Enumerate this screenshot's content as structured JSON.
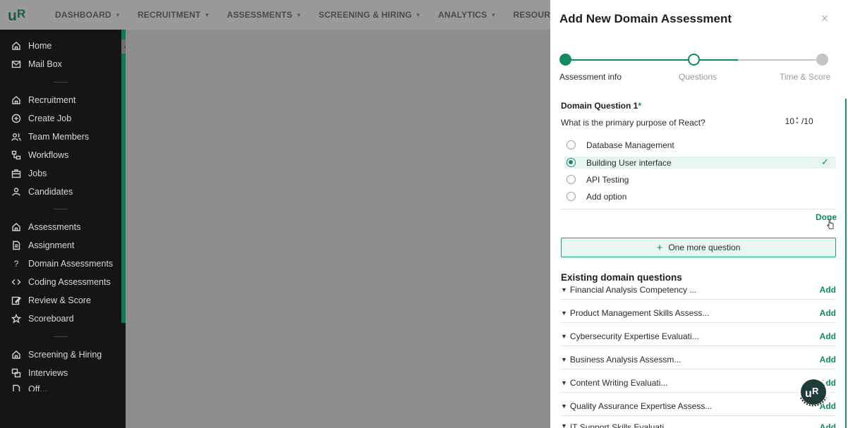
{
  "nav": {
    "logo": "uR",
    "items": [
      {
        "label": "DASHBOARD"
      },
      {
        "label": "RECRUITMENT"
      },
      {
        "label": "ASSESSMENTS"
      },
      {
        "label": "SCREENING & HIRING"
      },
      {
        "label": "ANALYTICS"
      },
      {
        "label": "RESOURCES"
      }
    ]
  },
  "sidebar": {
    "items": [
      {
        "label": "Home",
        "icon": "home-icon"
      },
      {
        "label": "Mail Box",
        "icon": "mail-icon"
      },
      {
        "label": "Recruitment",
        "icon": "home-icon"
      },
      {
        "label": "Create Job",
        "icon": "plus-circle-icon"
      },
      {
        "label": "Team Members",
        "icon": "users-icon"
      },
      {
        "label": "Workflows",
        "icon": "workflow-icon"
      },
      {
        "label": "Jobs",
        "icon": "briefcase-icon"
      },
      {
        "label": "Candidates",
        "icon": "user-icon"
      },
      {
        "label": "Assessments",
        "icon": "home-icon"
      },
      {
        "label": "Assignment",
        "icon": "document-icon"
      },
      {
        "label": "Domain Assessments",
        "icon": "question-icon"
      },
      {
        "label": "Coding Assessments",
        "icon": "code-icon"
      },
      {
        "label": "Review & Score",
        "icon": "edit-icon"
      },
      {
        "label": "Scoreboard",
        "icon": "star-icon"
      },
      {
        "label": "Screening & Hiring",
        "icon": "home-icon"
      },
      {
        "label": "Interviews",
        "icon": "interviews-icon"
      },
      {
        "label": "Off...",
        "icon": "document-icon"
      }
    ]
  },
  "drawer": {
    "title": "Add New Domain Assessment",
    "steps": [
      "Assessment info",
      "Questions",
      "Time & Score"
    ],
    "question": {
      "title": "Domain Question 1",
      "required_mark": "*",
      "text": "What is the primary purpose of React?",
      "score": "10",
      "max_score": "/10",
      "options": [
        {
          "label": "Database Management",
          "selected": false
        },
        {
          "label": "Building User interface",
          "selected": true
        },
        {
          "label": "API Testing",
          "selected": false
        },
        {
          "label": "Add option",
          "selected": false
        }
      ]
    },
    "done_label": "Done",
    "more_question_label": "One more question",
    "existing_title": "Existing domain questions",
    "add_label": "Add",
    "existing": [
      "Financial Analysis Competency ...",
      "Product Management Skills Assess...",
      "Cybersecurity Expertise Evaluati...",
      "Business Analysis Assessm...",
      "Content Writing Evaluati...",
      "Quality Assurance Expertise Assess...",
      "IT Support Skills Evaluati..."
    ]
  },
  "colors": {
    "accent": "#0f8a62",
    "sidebar_bg": "#151515",
    "overlay": "#8d8d8d"
  }
}
